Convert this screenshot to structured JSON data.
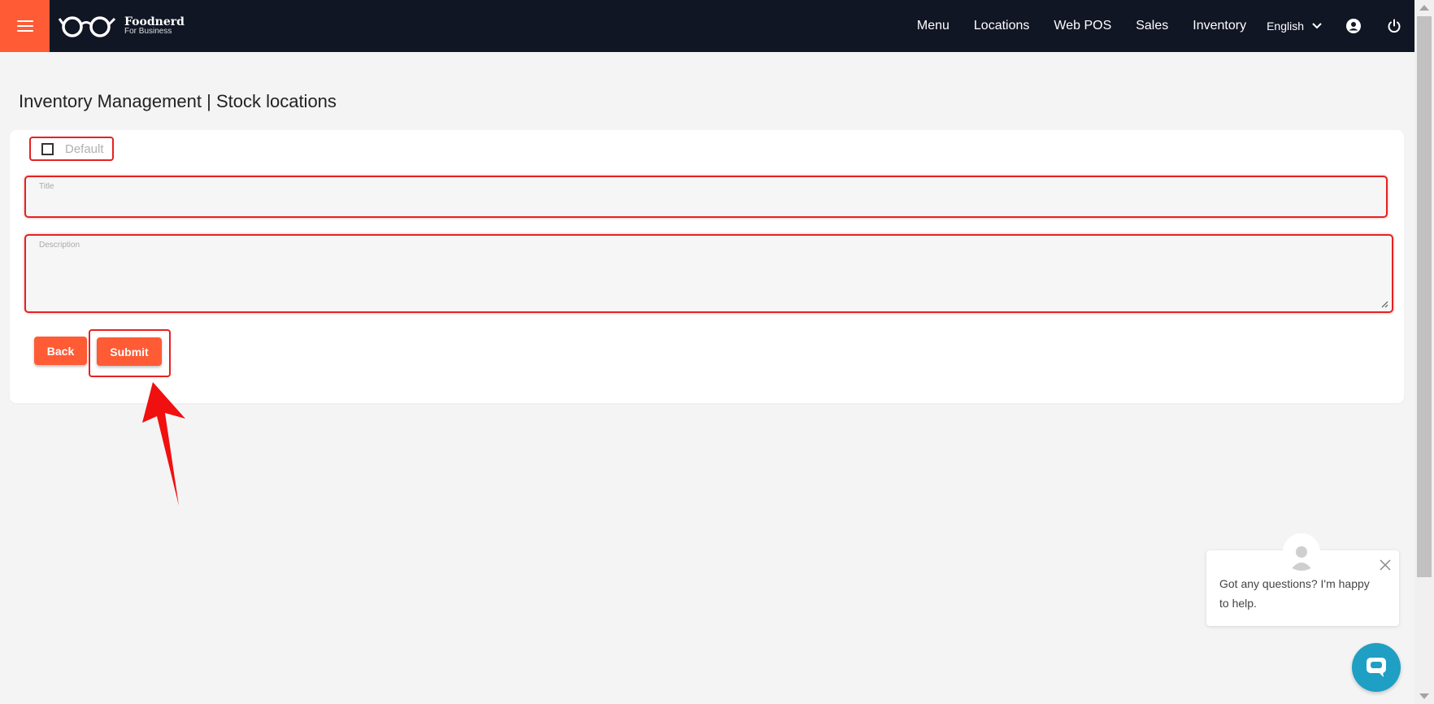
{
  "brand": {
    "name": "Foodnerd",
    "tagline": "For Business",
    "accent": "#ff5b35",
    "nav_bg": "#111625"
  },
  "nav": {
    "items": [
      "Menu",
      "Locations",
      "Web POS",
      "Sales",
      "Inventory"
    ],
    "language": "English",
    "icons": [
      "account-icon",
      "power-icon"
    ]
  },
  "page": {
    "title": "Inventory Management | Stock locations"
  },
  "form": {
    "default_label": "Default",
    "default_checked": false,
    "title_label": "Title",
    "title_value": "",
    "description_label": "Description",
    "description_value": "",
    "back_label": "Back",
    "submit_label": "Submit"
  },
  "chat": {
    "message": "Got any questions? I'm happy to help."
  },
  "annotation": {
    "highlight_color": "#e52222"
  }
}
